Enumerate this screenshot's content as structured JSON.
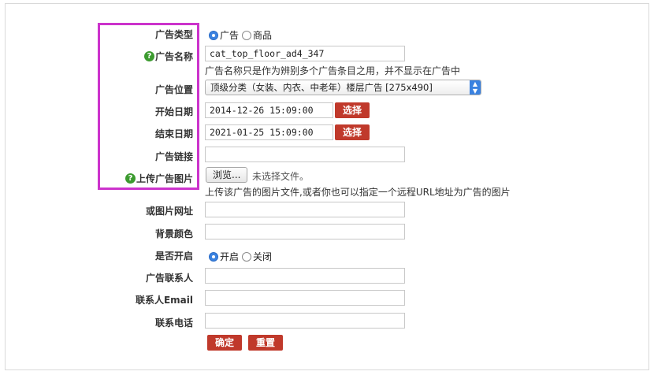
{
  "form": {
    "ad_type": {
      "label": "广告类型",
      "options": [
        "广告",
        "商品"
      ],
      "selected": 0
    },
    "ad_name": {
      "label": "广告名称",
      "value": "cat_top_floor_ad4_347",
      "hint": "广告名称只是作为辨别多个广告条目之用，并不显示在广告中"
    },
    "ad_position": {
      "label": "广告位置",
      "value": "顶级分类（女装、内衣、中老年）楼层广告 [275x490]"
    },
    "start_date": {
      "label": "开始日期",
      "value": "2014-12-26 15:09:00",
      "button": "选择"
    },
    "end_date": {
      "label": "结束日期",
      "value": "2021-01-25 15:09:00",
      "button": "选择"
    },
    "ad_link": {
      "label": "广告链接",
      "value": ""
    },
    "upload_image": {
      "label": "上传广告图片",
      "button": "浏览...",
      "status": "未选择文件。",
      "hint": "上传该广告的图片文件,或者你也可以指定一个远程URL地址为广告的图片"
    },
    "image_url": {
      "label": "或图片网址",
      "value": ""
    },
    "bg_color": {
      "label": "背景颜色",
      "value": ""
    },
    "enabled": {
      "label": "是否开启",
      "options": [
        "开启",
        "关闭"
      ],
      "selected": 0
    },
    "contact": {
      "label": "广告联系人",
      "value": ""
    },
    "contact_email": {
      "label": "联系人Email",
      "value": ""
    },
    "contact_phone": {
      "label": "联系电话",
      "value": ""
    },
    "submit": "确定",
    "reset": "重置"
  },
  "colors": {
    "highlight": "#cc33cc",
    "button": "#c0392b",
    "help": "#3c9b2f",
    "radio": "#3b82e0"
  }
}
